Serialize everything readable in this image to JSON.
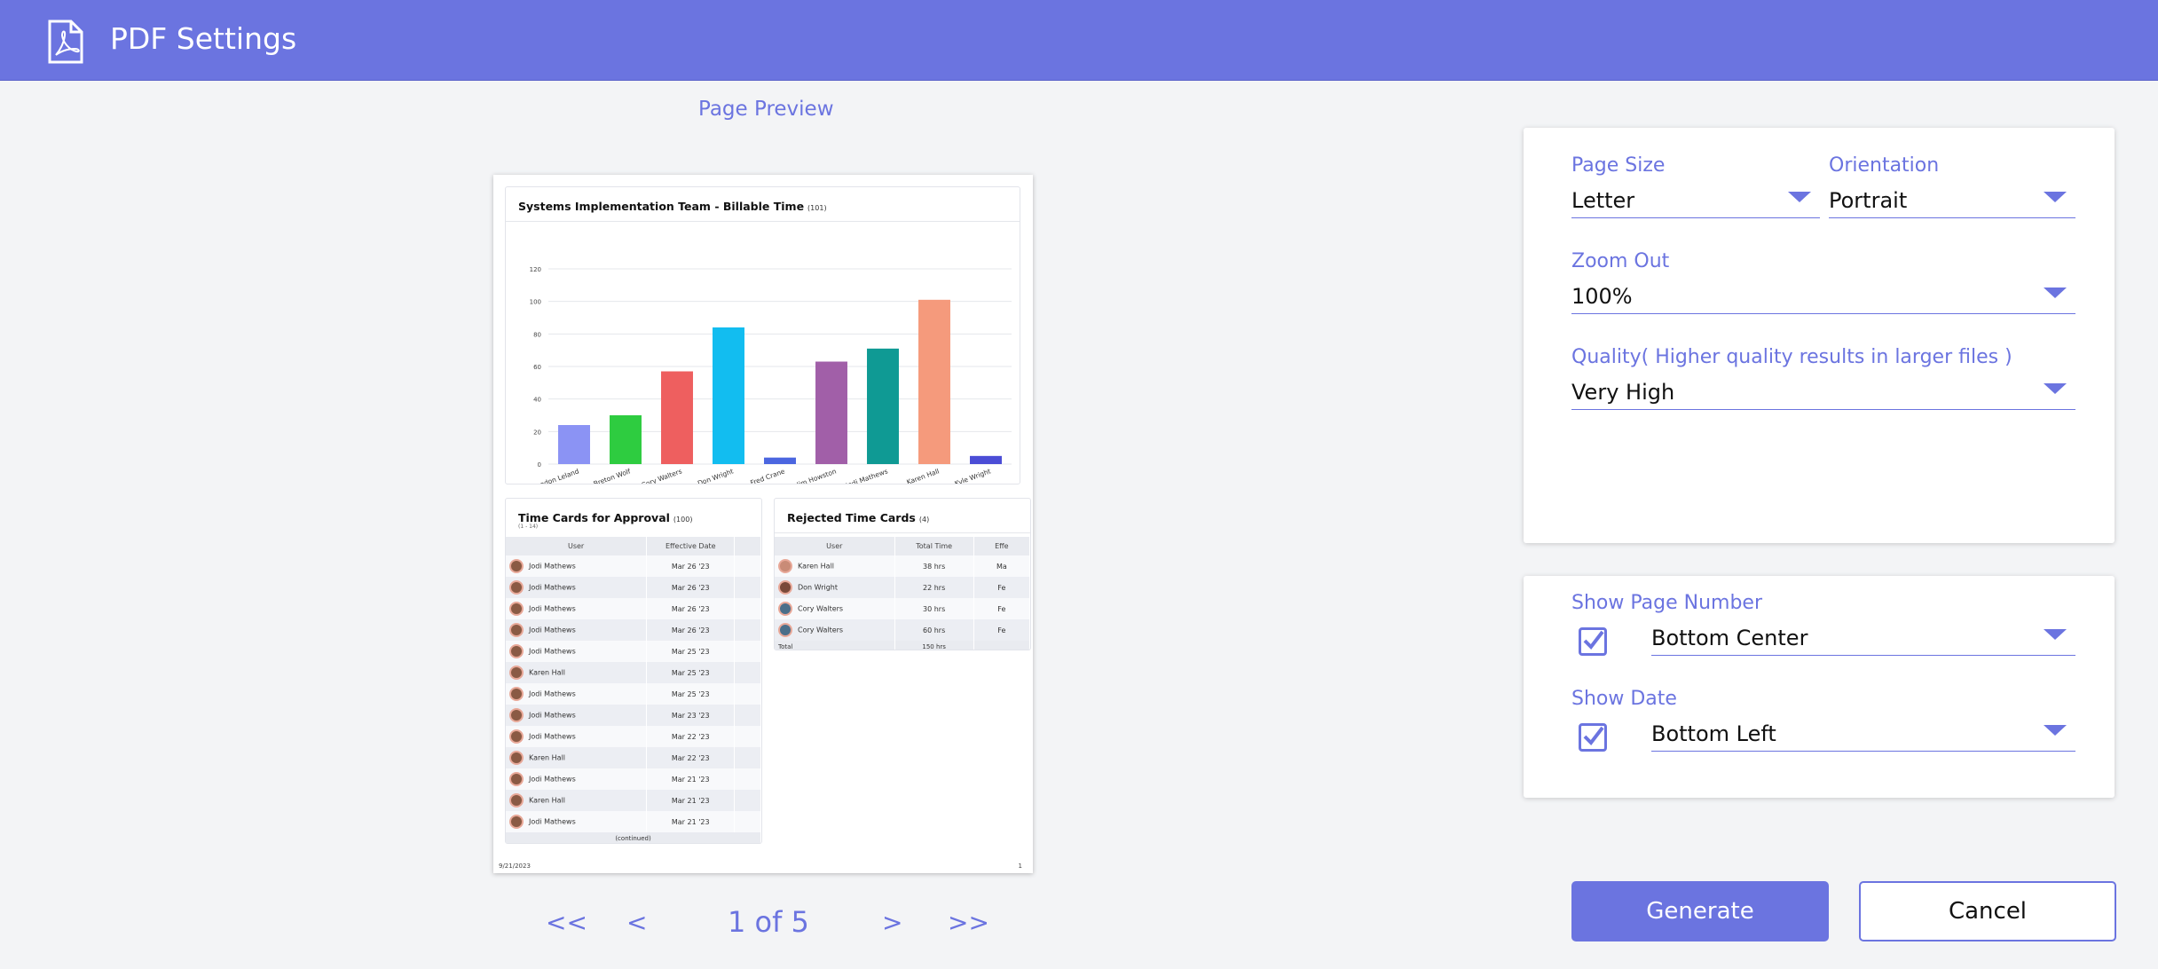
{
  "header": {
    "title": "PDF Settings",
    "icon": "pdf-icon"
  },
  "preview": {
    "label": "Page Preview",
    "chart_card": {
      "title": "Systems Implementation Team - Billable Time",
      "count": "(101)"
    },
    "chart_data": {
      "type": "bar",
      "title": "Systems Implementation Team - Billable Time",
      "xlabel": "",
      "ylabel": "",
      "ylim": [
        0,
        120
      ],
      "yticks": [
        "0",
        "20",
        "40",
        "60",
        "80",
        "100",
        "120"
      ],
      "categories": [
        "Brandon Leland",
        "Breton Wolf",
        "Cory Walters",
        "Don Wright",
        "Fred Crane",
        "Jim Howston",
        "Jodi Mathews",
        "Karen Hall",
        "Kyle Wright"
      ],
      "values": [
        24,
        30,
        57,
        84,
        4,
        63,
        71,
        101,
        5
      ],
      "colors": [
        "#8b93f4",
        "#2ecc40",
        "#ee5f5f",
        "#12bdf0",
        "#4b66e0",
        "#a15fa8",
        "#0f9a94",
        "#f59a7c",
        "#4b4dd6"
      ],
      "grid": true
    },
    "approval_card": {
      "title": "Time Cards for Approval",
      "count": "(100)",
      "sub": "(1 - 14)",
      "columns": [
        "User",
        "Effective Date"
      ],
      "rows": [
        [
          "Jodi Mathews",
          "Mar 26 '23"
        ],
        [
          "Jodi Mathews",
          "Mar 26 '23"
        ],
        [
          "Jodi Mathews",
          "Mar 26 '23"
        ],
        [
          "Jodi Mathews",
          "Mar 26 '23"
        ],
        [
          "Jodi Mathews",
          "Mar 25 '23"
        ],
        [
          "Karen Hall",
          "Mar 25 '23"
        ],
        [
          "Jodi Mathews",
          "Mar 25 '23"
        ],
        [
          "Jodi Mathews",
          "Mar 23 '23"
        ],
        [
          "Jodi Mathews",
          "Mar 22 '23"
        ],
        [
          "Karen Hall",
          "Mar 22 '23"
        ],
        [
          "Jodi Mathews",
          "Mar 21 '23"
        ],
        [
          "Karen Hall",
          "Mar 21 '23"
        ],
        [
          "Jodi Mathews",
          "Mar 21 '23"
        ]
      ],
      "footer": "(continued)"
    },
    "rejected_card": {
      "title": "Rejected Time Cards",
      "count": "(4)",
      "columns": [
        "User",
        "Total Time",
        "Effe"
      ],
      "rows": [
        [
          "Karen Hall",
          "38 hrs",
          "Ma"
        ],
        [
          "Don Wright",
          "22 hrs",
          "Fe"
        ],
        [
          "Cory Walters",
          "30 hrs",
          "Fe"
        ],
        [
          "Cory Walters",
          "60 hrs",
          "Fe"
        ]
      ],
      "total_label": "Total",
      "total_value": "150 hrs"
    },
    "page_footer_left": "9/21/2023",
    "page_footer_right": "1"
  },
  "pager": {
    "first": "<<",
    "prev": "<",
    "label": "1 of 5",
    "next": ">",
    "last": ">>"
  },
  "settings": {
    "page_size": {
      "label": "Page Size",
      "value": "Letter"
    },
    "orientation": {
      "label": "Orientation",
      "value": "Portrait"
    },
    "zoom": {
      "label": "Zoom Out",
      "value": "100%"
    },
    "quality": {
      "label": "Quality( Higher quality results in larger files )",
      "value": "Very High"
    },
    "page_number": {
      "label": "Show Page Number",
      "checked": true,
      "value": "Bottom Center"
    },
    "date": {
      "label": "Show Date",
      "checked": true,
      "value": "Bottom Left"
    }
  },
  "actions": {
    "generate": "Generate",
    "cancel": "Cancel"
  },
  "colors": {
    "accent": "#6b74e0",
    "header_bg": "#6b74e0",
    "page_bg": "#f3f4f6"
  }
}
